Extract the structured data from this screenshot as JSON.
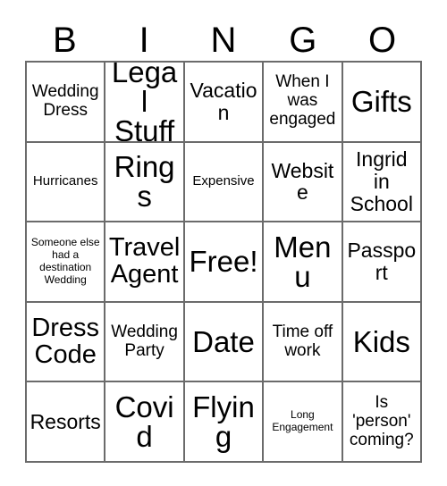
{
  "header": {
    "letters": [
      "B",
      "I",
      "N",
      "G",
      "O"
    ]
  },
  "grid": {
    "rows": 5,
    "columns": 5,
    "border_color": "#6b6b6b",
    "background_color": "#ffffff",
    "text_color": "#000000",
    "cells": [
      {
        "text": "Wedding Dress",
        "size": "md",
        "row": 1,
        "col": 1
      },
      {
        "text": "Legal Stuff",
        "size": "xxl",
        "row": 1,
        "col": 2
      },
      {
        "text": "Vacation",
        "size": "lg",
        "row": 1,
        "col": 3
      },
      {
        "text": "When I was engaged",
        "size": "md",
        "row": 1,
        "col": 4
      },
      {
        "text": "Gifts",
        "size": "xxl",
        "row": 1,
        "col": 5
      },
      {
        "text": "Hurricanes",
        "size": "sm",
        "row": 2,
        "col": 1
      },
      {
        "text": "Rings",
        "size": "xxl",
        "row": 2,
        "col": 2
      },
      {
        "text": "Expensive",
        "size": "sm",
        "row": 2,
        "col": 3
      },
      {
        "text": "Website",
        "size": "lg",
        "row": 2,
        "col": 4
      },
      {
        "text": "Ingrid in School",
        "size": "lg",
        "row": 2,
        "col": 5
      },
      {
        "text": "Someone else had a destination Wedding",
        "size": "xs",
        "row": 3,
        "col": 1
      },
      {
        "text": "Travel Agent",
        "size": "xl",
        "row": 3,
        "col": 2
      },
      {
        "text": "Free!",
        "size": "xxl",
        "row": 3,
        "col": 3
      },
      {
        "text": "Menu",
        "size": "xxl",
        "row": 3,
        "col": 4
      },
      {
        "text": "Passport",
        "size": "lg",
        "row": 3,
        "col": 5
      },
      {
        "text": "Dress Code",
        "size": "xl",
        "row": 4,
        "col": 1
      },
      {
        "text": "Wedding Party",
        "size": "md",
        "row": 4,
        "col": 2
      },
      {
        "text": "Date",
        "size": "xxl",
        "row": 4,
        "col": 3
      },
      {
        "text": "Time off work",
        "size": "md",
        "row": 4,
        "col": 4
      },
      {
        "text": "Kids",
        "size": "xxl",
        "row": 4,
        "col": 5
      },
      {
        "text": "Resorts",
        "size": "lg",
        "row": 5,
        "col": 1
      },
      {
        "text": "Covid",
        "size": "xxl",
        "row": 5,
        "col": 2
      },
      {
        "text": "Flying",
        "size": "xxl",
        "row": 5,
        "col": 3
      },
      {
        "text": "Long Engagement",
        "size": "xs",
        "row": 5,
        "col": 4
      },
      {
        "text": "Is 'person' coming?",
        "size": "md",
        "row": 5,
        "col": 5
      }
    ]
  }
}
